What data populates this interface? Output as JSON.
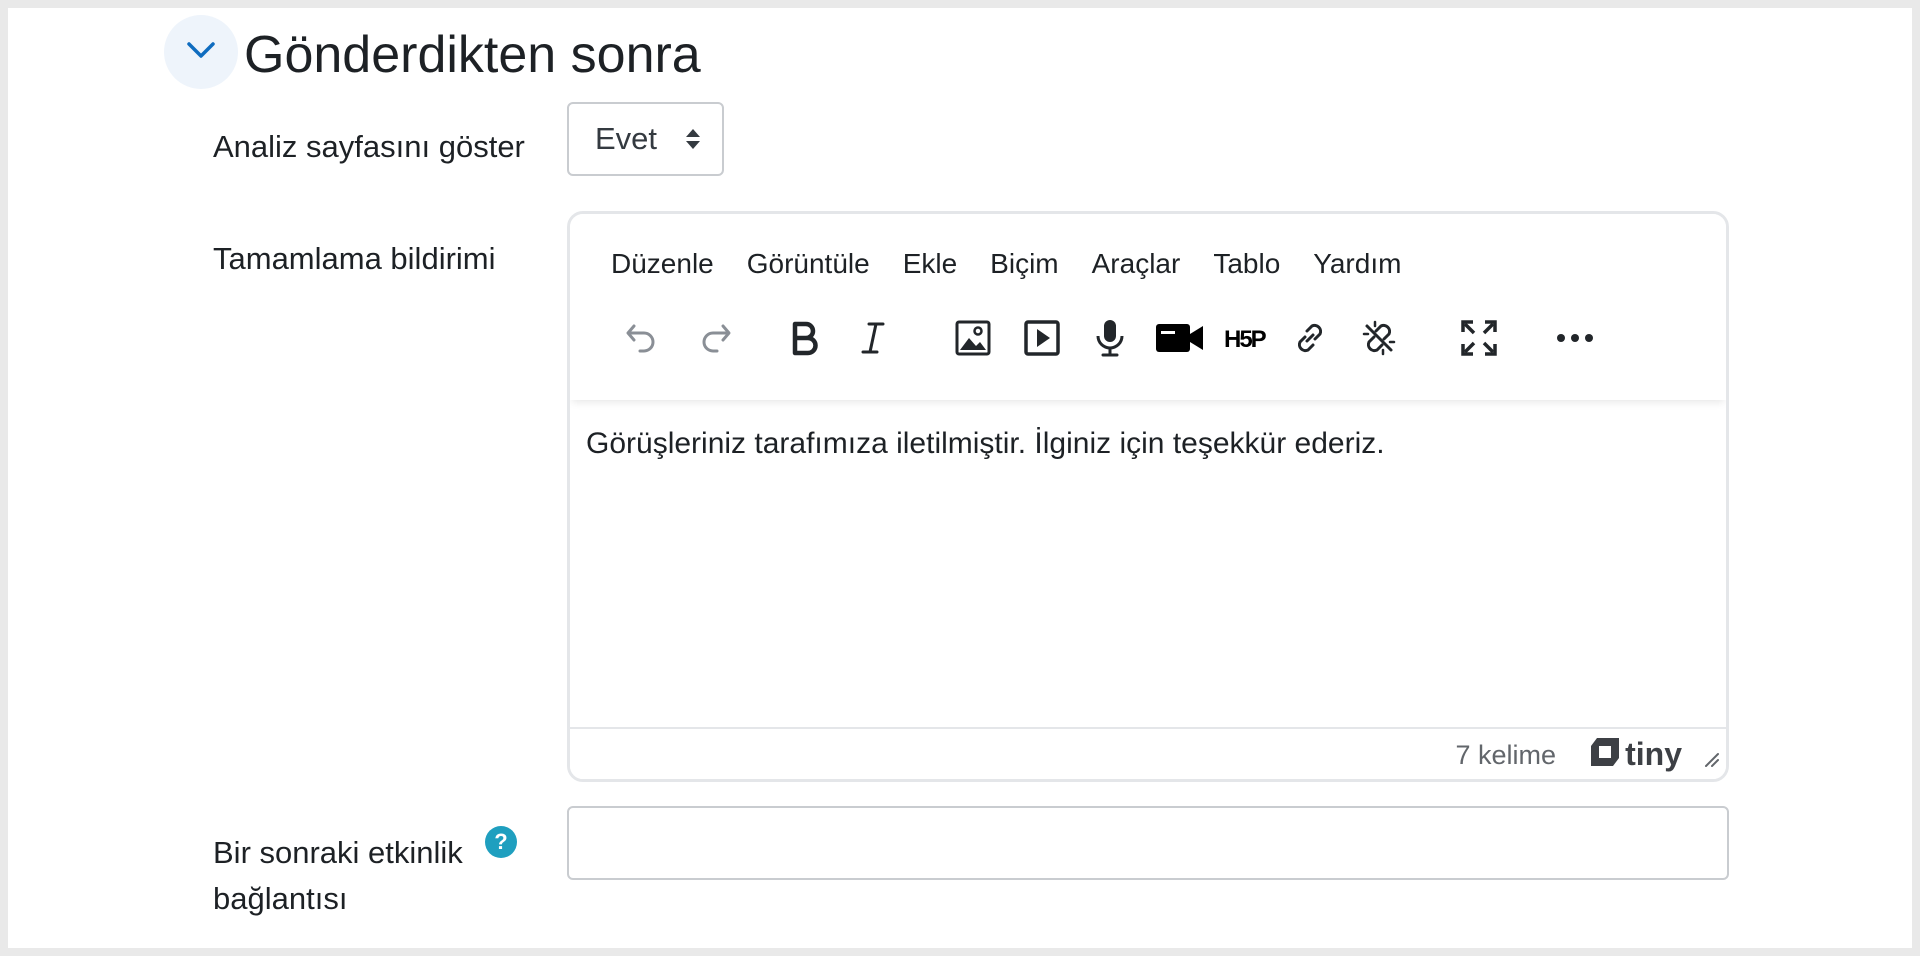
{
  "section": {
    "title": "Gönderdikten sonra"
  },
  "fields": {
    "analysis_label": "Analiz sayfasını göster",
    "analysis_value": "Evet",
    "completion_label": "Tamamlama bildirimi",
    "next_activity_label_line1": "Bir sonraki etkinlik",
    "next_activity_label_line2": "bağlantısı",
    "next_activity_value": ""
  },
  "editor": {
    "menu": [
      "Düzenle",
      "Görüntüle",
      "Ekle",
      "Biçim",
      "Araçlar",
      "Tablo",
      "Yardım"
    ],
    "toolbar_icons": [
      "undo-icon",
      "redo-icon",
      "bold-icon",
      "italic-icon",
      "image-icon",
      "media-icon",
      "microphone-icon",
      "video-camera-icon",
      "h5p-icon",
      "link-icon",
      "unlink-icon",
      "fullscreen-icon",
      "more-icon"
    ],
    "content": "Görüşleriniz tarafımıza iletilmiştir. İlginiz için teşekkür ederiz.",
    "word_count": "7 kelime",
    "brand": "tiny"
  },
  "colors": {
    "accent": "#0f6cbf",
    "help": "#1f9fbf",
    "text": "#1d2125"
  }
}
